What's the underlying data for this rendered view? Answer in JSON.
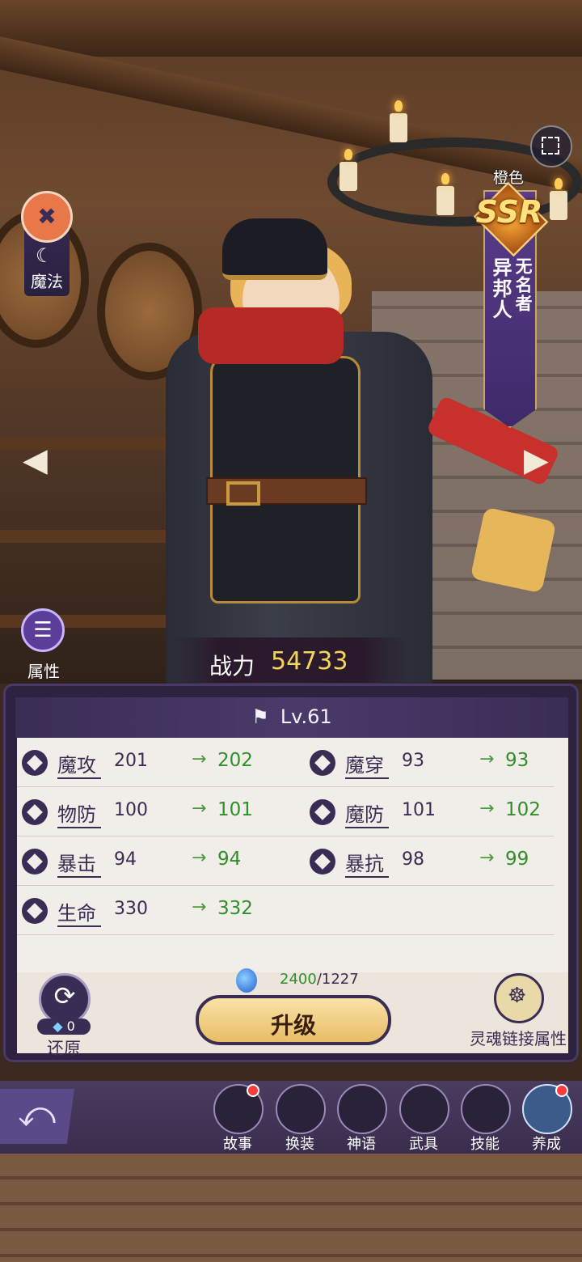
{
  "top_right": {
    "color_label": "橙色",
    "rarity": "SSR",
    "title_line1": "无名者",
    "title_line2": "异邦人"
  },
  "class": {
    "label": "魔法"
  },
  "attributes_button": {
    "label": "属性"
  },
  "power": {
    "label": "战力",
    "value": "54733"
  },
  "panel": {
    "level": "Lv.61",
    "stats": [
      {
        "name": "魔攻",
        "current": "201",
        "next": "202"
      },
      {
        "name": "魔穿",
        "current": "93",
        "next": "93"
      },
      {
        "name": "物防",
        "current": "100",
        "next": "101"
      },
      {
        "name": "魔防",
        "current": "101",
        "next": "102"
      },
      {
        "name": "暴击",
        "current": "94",
        "next": "94"
      },
      {
        "name": "暴抗",
        "current": "98",
        "next": "99"
      },
      {
        "name": "生命",
        "current": "330",
        "next": "332"
      }
    ],
    "cost_have": "2400",
    "cost_need": "/1227",
    "reset_count": "0",
    "reset_label": "还原",
    "upgrade_label": "升级",
    "soul_label": "灵魂链接属性"
  },
  "nav": [
    {
      "label": "故事",
      "badge": true
    },
    {
      "label": "换装",
      "badge": false
    },
    {
      "label": "神语",
      "badge": false
    },
    {
      "label": "武具",
      "badge": false
    },
    {
      "label": "技能",
      "badge": false
    },
    {
      "label": "养成",
      "badge": true,
      "active": true
    }
  ],
  "colors": {
    "panel_purple": "#2d2240",
    "gain_green": "#2f8f2a",
    "power_gold": "#f4d45a"
  }
}
